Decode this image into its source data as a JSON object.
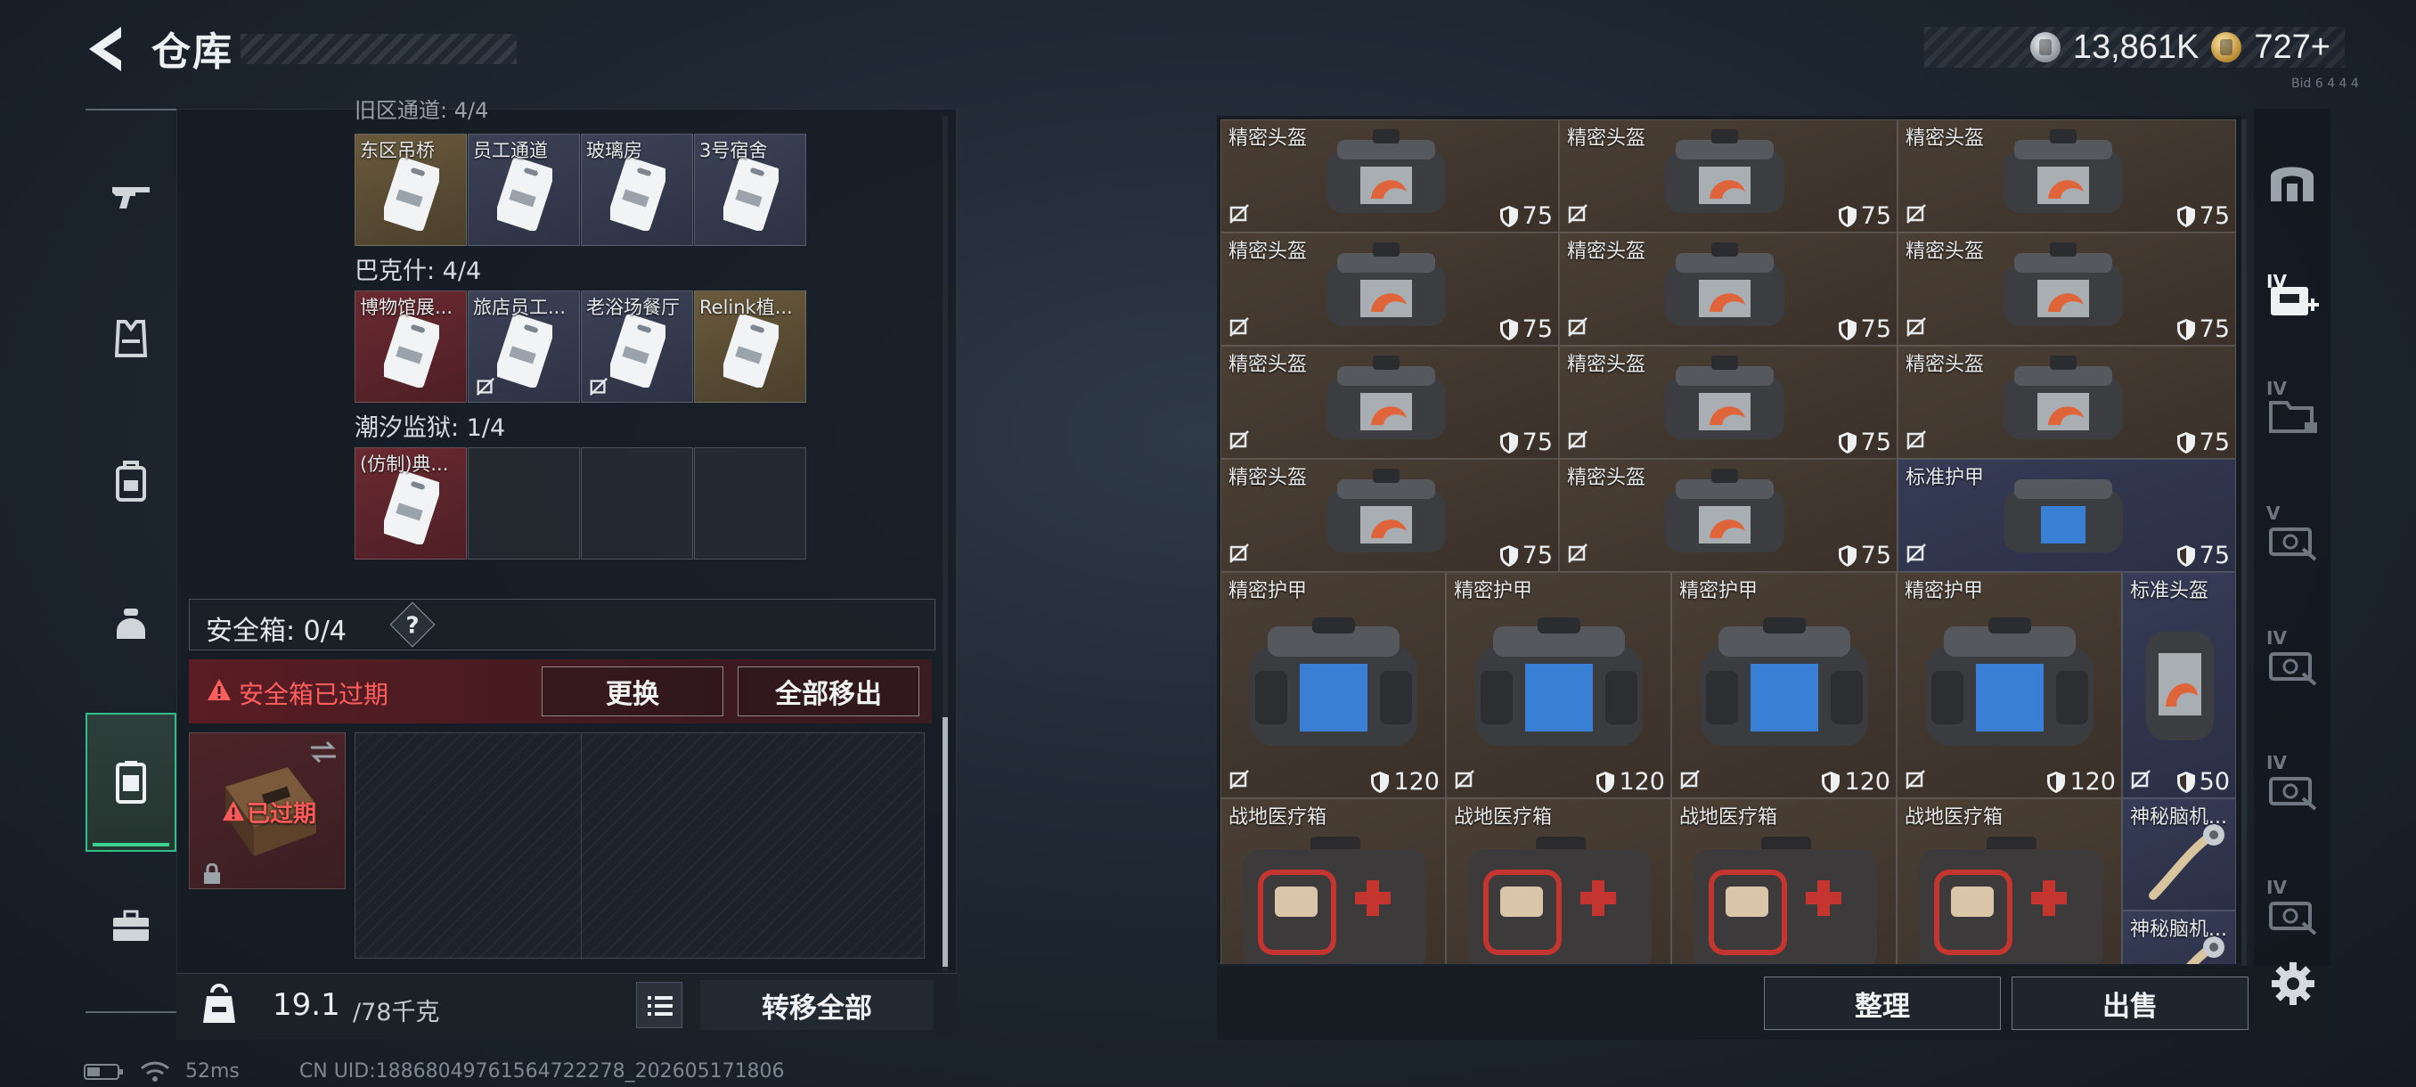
{
  "header": {
    "title": "仓库",
    "currency": [
      {
        "icon": "silver-coin-icon",
        "value": "13,861K"
      },
      {
        "icon": "gold-coin-icon",
        "value": "727+"
      }
    ],
    "corner_tag": "Bid 6 4 4 4"
  },
  "nav": {
    "items": [
      {
        "icon": "gun-icon"
      },
      {
        "icon": "vest-icon"
      },
      {
        "icon": "backpack-icon"
      },
      {
        "icon": "helmet-icon"
      },
      {
        "icon": "safe-box-icon",
        "active": true
      },
      {
        "icon": "toolbox-icon"
      }
    ]
  },
  "keycards": {
    "partial_group_label": "旧区通道: 4/4",
    "groups": [
      {
        "label": "",
        "cards": [
          {
            "name": "东区吊桥",
            "color": "gold"
          },
          {
            "name": "员工通道",
            "color": "blue"
          },
          {
            "name": "玻璃房",
            "color": "blue"
          },
          {
            "name": "3号宿舍",
            "color": "blue"
          }
        ]
      },
      {
        "label": "巴克什: 4/4",
        "cards": [
          {
            "name": "博物馆展...",
            "color": "red"
          },
          {
            "name": "旅店员工...",
            "color": "blue",
            "no_trade": true
          },
          {
            "name": "老浴场餐厅",
            "color": "blue",
            "no_trade": true
          },
          {
            "name": "Relink植...",
            "color": "gold"
          }
        ]
      },
      {
        "label": "潮汐监狱: 1/4",
        "cards": [
          {
            "name": "(仿制)典...",
            "color": "red"
          }
        ]
      }
    ]
  },
  "safe_box": {
    "title": "安全箱: 0/4",
    "help": "?",
    "expired_msg": "安全箱已过期",
    "replace_btn": "更换",
    "move_all_btn": "全部移出",
    "item_status": "已过期"
  },
  "weight": {
    "current": "19.1",
    "max": "/78千克"
  },
  "transfer_all": "转移全部",
  "status": {
    "ping": "52ms",
    "uid": "CN UID:18868049761564722278_202605171806"
  },
  "stash": {
    "items": [
      {
        "name": "精密头盔",
        "dur": "75",
        "color": "brown",
        "art": "helmet"
      },
      {
        "name": "精密头盔",
        "dur": "75",
        "color": "brown",
        "art": "helmet"
      },
      {
        "name": "精密头盔",
        "dur": "75",
        "color": "brown",
        "art": "helmet"
      },
      {
        "name": "精密头盔",
        "dur": "75",
        "color": "brown",
        "art": "helmet"
      },
      {
        "name": "精密头盔",
        "dur": "75",
        "color": "brown",
        "art": "helmet"
      },
      {
        "name": "精密头盔",
        "dur": "75",
        "color": "brown",
        "art": "helmet"
      },
      {
        "name": "精密头盔",
        "dur": "75",
        "color": "brown",
        "art": "helmet"
      },
      {
        "name": "精密头盔",
        "dur": "75",
        "color": "brown",
        "art": "helmet"
      },
      {
        "name": "精密头盔",
        "dur": "75",
        "color": "brown",
        "art": "helmet"
      },
      {
        "name": "精密头盔",
        "dur": "75",
        "color": "brown",
        "art": "helmet"
      },
      {
        "name": "精密头盔",
        "dur": "75",
        "color": "brown",
        "art": "helmet"
      },
      {
        "name": "标准护甲",
        "dur": "75",
        "color": "navy",
        "art": "armor-small"
      },
      {
        "name": "精密护甲",
        "dur": "120",
        "color": "brown",
        "art": "armor"
      },
      {
        "name": "精密护甲",
        "dur": "120",
        "color": "brown",
        "art": "armor"
      },
      {
        "name": "精密护甲",
        "dur": "120",
        "color": "brown",
        "art": "armor"
      },
      {
        "name": "精密护甲",
        "dur": "120",
        "color": "brown",
        "art": "armor"
      },
      {
        "name": "标准头盔",
        "dur": "50",
        "color": "navy",
        "art": "helmet-side"
      },
      {
        "name": "战地医疗箱",
        "color": "brown",
        "art": "medkit"
      },
      {
        "name": "战地医疗箱",
        "color": "brown",
        "art": "medkit"
      },
      {
        "name": "战地医疗箱",
        "color": "brown",
        "art": "medkit"
      },
      {
        "name": "战地医疗箱",
        "color": "brown",
        "art": "medkit"
      },
      {
        "name": "神秘脑机...",
        "color": "navy",
        "art": "chip"
      },
      {
        "name": "神秘脑机...",
        "color": "navy",
        "art": "chip"
      }
    ],
    "sort_btn": "整理",
    "sell_btn": "出售"
  },
  "right_strip": {
    "items": [
      {
        "icon": "stash-tab-icon"
      },
      {
        "icon": "add-stash-icon",
        "label": "IV"
      },
      {
        "icon": "folder-icon",
        "label": "IV"
      },
      {
        "icon": "box-icon",
        "label": "V"
      },
      {
        "icon": "box-icon",
        "label": "IV"
      },
      {
        "icon": "box-icon",
        "label": "IV"
      },
      {
        "icon": "box-icon",
        "label": "IV"
      }
    ]
  },
  "colors": {
    "accent": "#39d293",
    "danger": "#ff5e5e",
    "gold_card": "#6a5a3c",
    "blue_card": "#3c4256",
    "red_card": "#6a2a30"
  }
}
